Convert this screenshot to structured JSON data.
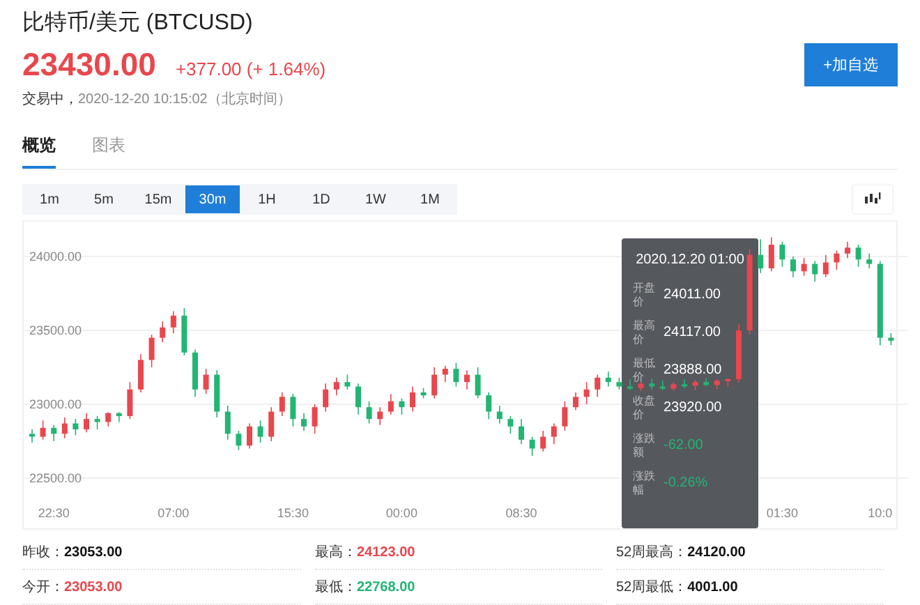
{
  "header": {
    "title": "比特币/美元 (BTCUSD)",
    "price": "23430.00",
    "change": "+377.00 (+ 1.64%)",
    "status": "交易中，",
    "timestamp": "2020-12-20 10:15:02（北京时间）",
    "watch_button": "+加自选"
  },
  "tabs": [
    {
      "label": "概览",
      "selected": true
    },
    {
      "label": "图表",
      "selected": false
    }
  ],
  "periods": [
    {
      "label": "1m",
      "selected": false
    },
    {
      "label": "5m",
      "selected": false
    },
    {
      "label": "15m",
      "selected": false
    },
    {
      "label": "30m",
      "selected": true
    },
    {
      "label": "1H",
      "selected": false
    },
    {
      "label": "1D",
      "selected": false
    },
    {
      "label": "1W",
      "selected": false
    },
    {
      "label": "1M",
      "selected": false
    }
  ],
  "chart": {
    "chart_data": {
      "type": "candlestick",
      "categories": [
        null,
        null,
        "22:30",
        null,
        null,
        null,
        null,
        null,
        null,
        null,
        null,
        null,
        null,
        "07:00",
        null,
        null,
        null,
        null,
        null,
        null,
        null,
        null,
        null,
        null,
        "15:30",
        null,
        null,
        null,
        null,
        null,
        null,
        null,
        null,
        null,
        "00:00",
        null,
        null,
        null,
        null,
        null,
        null,
        null,
        null,
        null,
        null,
        "08:30",
        null,
        null,
        null,
        null,
        null,
        null,
        null,
        null,
        null,
        null,
        null,
        null,
        null,
        null,
        null,
        null,
        null,
        null,
        null,
        null,
        null,
        null,
        null,
        "01:30",
        null,
        null,
        null,
        null,
        null,
        null,
        null,
        null,
        "10:0",
        null
      ],
      "ylim": [
        22160,
        24236
      ],
      "grid": true,
      "yticks": [
        {
          "value": 24000,
          "label": "24000.00"
        },
        {
          "value": 23500,
          "label": "23500.00"
        },
        {
          "value": 23000,
          "label": "23000.00"
        },
        {
          "value": 22500,
          "label": "22500.00"
        }
      ],
      "ohlc": [
        [
          22800,
          22830,
          22740,
          22780
        ],
        [
          22780,
          22890,
          22760,
          22840
        ],
        [
          22840,
          22860,
          22750,
          22800
        ],
        [
          22800,
          22910,
          22770,
          22870
        ],
        [
          22870,
          22900,
          22790,
          22830
        ],
        [
          22830,
          22940,
          22810,
          22900
        ],
        [
          22900,
          22920,
          22830,
          22880
        ],
        [
          22880,
          22945,
          22850,
          22940
        ],
        [
          22940,
          22945,
          22880,
          22920
        ],
        [
          22920,
          23150,
          22900,
          23100
        ],
        [
          23100,
          23340,
          23080,
          23300
        ],
        [
          23300,
          23470,
          23250,
          23450
        ],
        [
          23450,
          23560,
          23420,
          23520
        ],
        [
          23520,
          23630,
          23480,
          23600
        ],
        [
          23600,
          23650,
          23330,
          23350
        ],
        [
          23350,
          23370,
          23050,
          23100
        ],
        [
          23100,
          23240,
          23070,
          23200
        ],
        [
          23200,
          23230,
          22910,
          22950
        ],
        [
          22950,
          22990,
          22760,
          22800
        ],
        [
          22800,
          22820,
          22690,
          22720
        ],
        [
          22720,
          22870,
          22700,
          22850
        ],
        [
          22850,
          22890,
          22740,
          22780
        ],
        [
          22780,
          22980,
          22750,
          22950
        ],
        [
          22950,
          23080,
          22920,
          23050
        ],
        [
          23050,
          23070,
          22850,
          22900
        ],
        [
          22900,
          22940,
          22820,
          22850
        ],
        [
          22850,
          23000,
          22800,
          22980
        ],
        [
          22980,
          23140,
          22950,
          23100
        ],
        [
          23100,
          23180,
          23060,
          23150
        ],
        [
          23150,
          23200,
          23100,
          23120
        ],
        [
          23120,
          23140,
          22930,
          22980
        ],
        [
          22980,
          23020,
          22870,
          22900
        ],
        [
          22900,
          22980,
          22860,
          22950
        ],
        [
          22950,
          23070,
          22930,
          23020
        ],
        [
          23020,
          23040,
          22930,
          22980
        ],
        [
          22980,
          23120,
          22950,
          23080
        ],
        [
          23080,
          23110,
          23040,
          23060
        ],
        [
          23060,
          23250,
          23040,
          23200
        ],
        [
          23200,
          23260,
          23150,
          23240
        ],
        [
          23240,
          23280,
          23120,
          23150
        ],
        [
          23150,
          23230,
          23100,
          23200
        ],
        [
          23200,
          23250,
          23040,
          23060
        ],
        [
          23060,
          23080,
          22900,
          22950
        ],
        [
          22950,
          22990,
          22870,
          22900
        ],
        [
          22900,
          22920,
          22800,
          22850
        ],
        [
          22850,
          22900,
          22730,
          22760
        ],
        [
          22760,
          22780,
          22650,
          22700
        ],
        [
          22700,
          22820,
          22680,
          22780
        ],
        [
          22780,
          22870,
          22730,
          22850
        ],
        [
          22850,
          23020,
          22820,
          22980
        ],
        [
          22980,
          23080,
          22960,
          23050
        ],
        [
          23050,
          23150,
          23000,
          23100
        ],
        [
          23100,
          23200,
          23050,
          23180
        ],
        [
          23180,
          23220,
          23120,
          23150
        ],
        [
          23150,
          23180,
          23100,
          23120
        ],
        [
          23120,
          23170,
          23095,
          23110
        ],
        [
          23110,
          23150,
          23090,
          23140
        ],
        [
          23140,
          23175,
          23100,
          23120
        ],
        [
          23120,
          23160,
          23095,
          23105
        ],
        [
          23105,
          23150,
          23090,
          23135
        ],
        [
          23135,
          23170,
          23110,
          23125
        ],
        [
          23125,
          23165,
          23095,
          23150
        ],
        [
          23150,
          23175,
          23120,
          23130
        ],
        [
          23130,
          23170,
          23100,
          23160
        ],
        [
          23160,
          23175,
          23120,
          23170
        ],
        [
          23170,
          23540,
          23150,
          23500
        ],
        [
          23500,
          24050,
          23470,
          24011
        ],
        [
          24011,
          24117,
          23888,
          23920
        ],
        [
          23920,
          24130,
          23900,
          24080
        ],
        [
          24080,
          24100,
          23930,
          23980
        ],
        [
          23980,
          24000,
          23860,
          23900
        ],
        [
          23900,
          23990,
          23870,
          23950
        ],
        [
          23950,
          23970,
          23830,
          23880
        ],
        [
          23880,
          24010,
          23860,
          23960
        ],
        [
          23960,
          24040,
          23910,
          24020
        ],
        [
          24020,
          24100,
          23990,
          24060
        ],
        [
          24060,
          24080,
          23930,
          23980
        ],
        [
          23980,
          24020,
          23920,
          23950
        ],
        [
          23950,
          23970,
          23400,
          23450
        ],
        [
          23450,
          23480,
          23400,
          23430
        ]
      ]
    },
    "tooltip": {
      "title": "2020.12.20 01:00",
      "rows": [
        {
          "label": "开盘价",
          "value": "24011.00",
          "color": "#ffffff"
        },
        {
          "label": "最高价",
          "value": "24117.00",
          "color": "#ffffff"
        },
        {
          "label": "最低价",
          "value": "23888.00",
          "color": "#ffffff"
        },
        {
          "label": "收盘价",
          "value": "23920.00",
          "color": "#ffffff"
        },
        {
          "label": "涨跌额",
          "value": "-62.00",
          "color": "#22b573"
        },
        {
          "label": "涨跌幅",
          "value": "-0.26%",
          "color": "#22b573"
        }
      ]
    }
  },
  "stats": [
    {
      "label": "昨收：",
      "value": "23053.00",
      "color": "#111111"
    },
    {
      "label": "最高：",
      "value": "24123.00",
      "color": "#e8474d"
    },
    {
      "label": "52周最高：",
      "value": "24120.00",
      "color": "#111111"
    },
    {
      "label": "今开：",
      "value": "23053.00",
      "color": "#e8474d"
    },
    {
      "label": "最低：",
      "value": "22768.00",
      "color": "#22b573"
    },
    {
      "label": "52周最低：",
      "value": "4001.00",
      "color": "#111111"
    }
  ]
}
